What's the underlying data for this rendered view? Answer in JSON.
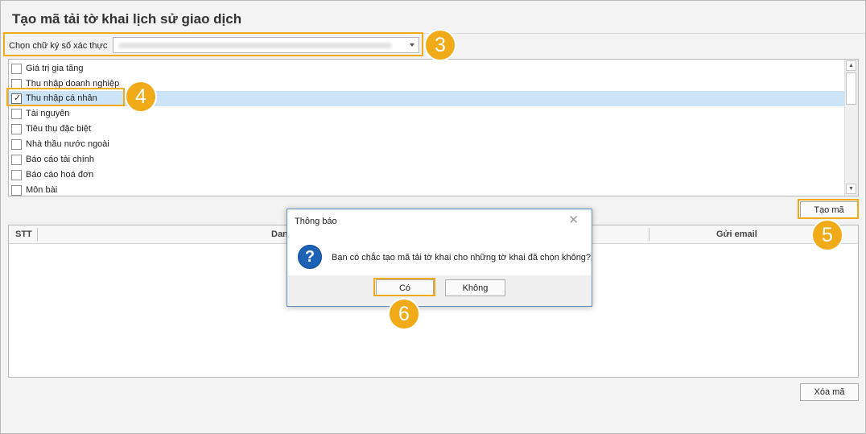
{
  "window": {
    "title": "Tạo mã tải tờ khai lịch sử giao dịch"
  },
  "signature": {
    "label": "Chọn chữ ký số xác thực"
  },
  "tax_types": [
    {
      "label": "Giá trị gia tăng",
      "checked": false
    },
    {
      "label": "Thu nhập doanh nghiệp",
      "checked": false
    },
    {
      "label": "Thu nhập cá nhân",
      "checked": true
    },
    {
      "label": "Tài nguyên",
      "checked": false
    },
    {
      "label": "Tiêu thụ đặc biệt",
      "checked": false
    },
    {
      "label": "Nhà thầu nước ngoài",
      "checked": false
    },
    {
      "label": "Báo cáo tài chính",
      "checked": false
    },
    {
      "label": "Báo cáo hoá đơn",
      "checked": false
    },
    {
      "label": "Môn bài",
      "checked": false
    }
  ],
  "buttons": {
    "create": "Tạo mã",
    "delete": "Xóa mã"
  },
  "table": {
    "columns": [
      "STT",
      "Dan",
      "Gửi email"
    ]
  },
  "dialog": {
    "title": "Thông báo",
    "message": "Bạn có chắc tạo mã tải tờ khai cho những tờ khai đã chọn không?",
    "yes": "Có",
    "no": "Không",
    "icon": "question-icon"
  },
  "annotations": [
    "3",
    "4",
    "5",
    "6"
  ],
  "colors": {
    "highlight": "#f1aa18",
    "selection": "#cce4f7",
    "question_icon": "#1d62b5"
  }
}
